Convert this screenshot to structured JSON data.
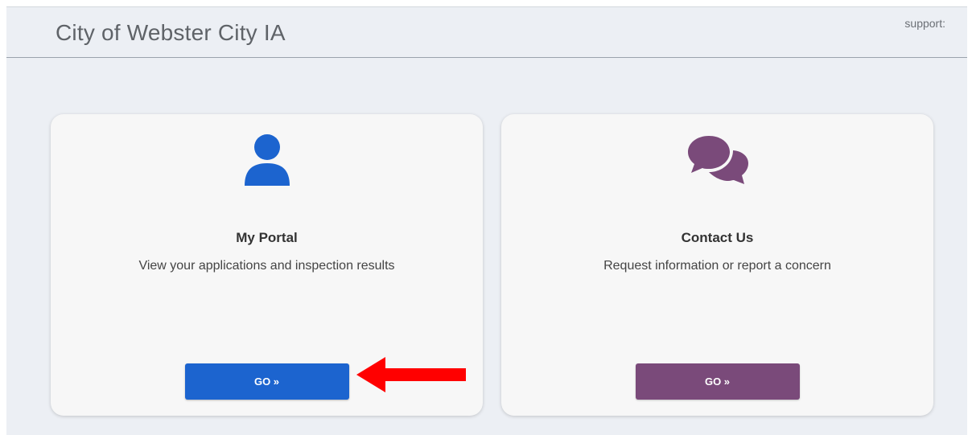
{
  "header": {
    "title": "City of Webster City IA",
    "support_label": "support:"
  },
  "cards": [
    {
      "title": "My Portal",
      "description": "View your applications and inspection results",
      "button_label": "GO »",
      "icon": "user-icon",
      "accent": "#1c64cf"
    },
    {
      "title": "Contact Us",
      "description": "Request information or report a concern",
      "button_label": "GO »",
      "icon": "chat-bubbles-icon",
      "accent": "#7a4a7a"
    }
  ],
  "annotation": {
    "icon": "red-arrow-icon",
    "color": "#ff0000"
  },
  "colors": {
    "background": "#eceff4",
    "card": "#f7f7f7"
  }
}
